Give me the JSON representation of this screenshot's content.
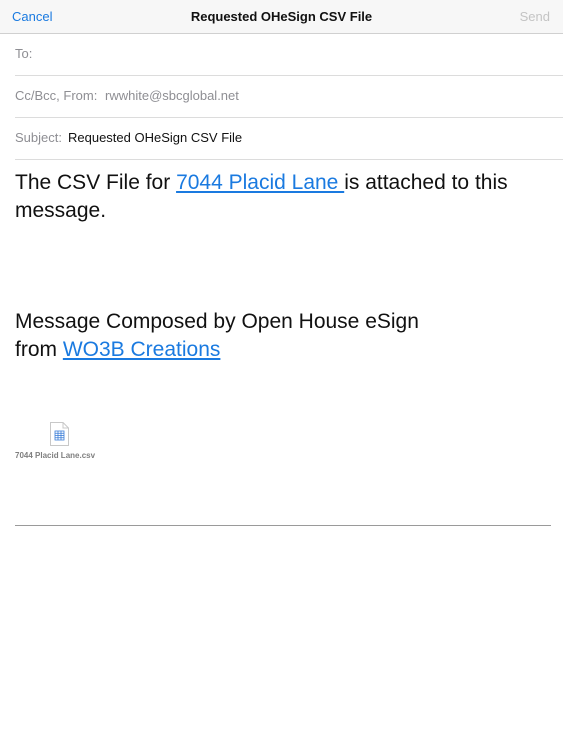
{
  "navbar": {
    "cancel_label": "Cancel",
    "title": "Requested OHeSign CSV File",
    "send_label": "Send"
  },
  "fields": {
    "to_label": "To:",
    "ccbcc_label": "Cc/Bcc, From:",
    "from_value": "rwwhite@sbcglobal.net",
    "subject_label": "Subject:",
    "subject_value": "Requested OHeSign CSV File"
  },
  "message": {
    "line1_prefix": "The CSV File for ",
    "address_link": "7044 Placid Lane ",
    "line1_suffix": "is attached to this message.",
    "composed_text": "Message Composed by Open House eSign",
    "from_word": "from ",
    "creator_link": "WO3B Creations"
  },
  "attachment": {
    "file_name": "7044 Placid Lane.csv",
    "icon": "csv-file-icon"
  },
  "colors": {
    "accent": "#1a7ae0",
    "disabled": "#c4c4c4",
    "label_gray": "#8e8e93"
  }
}
